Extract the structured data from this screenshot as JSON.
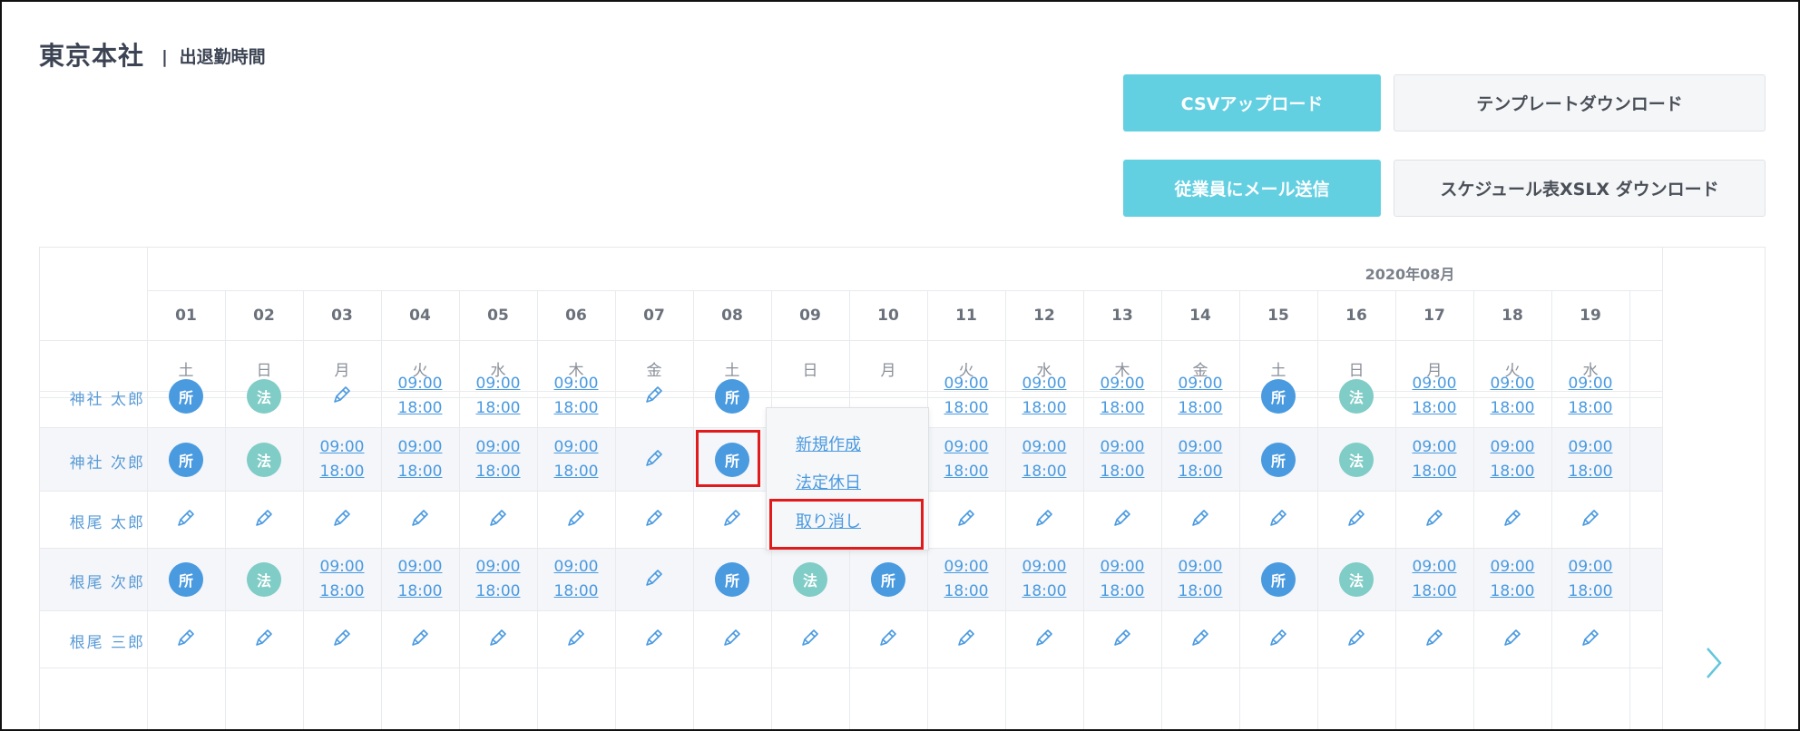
{
  "header": {
    "title": "東京本社",
    "subtitle_separator": "|",
    "subtitle": "出退勤時間"
  },
  "toolbar": {
    "csv_upload_label": "CSVアップロード",
    "template_download_label": "テンプレートダウンロード",
    "email_employees_label": "従業員にメール送信",
    "xlsx_download_label": "スケジュール表XSLX ダウンロード"
  },
  "colors": {
    "accent": "#63d0e2",
    "link": "#4a9ae0",
    "badge_sho": "#4a9ae0",
    "badge_ho": "#80ccc6",
    "highlight": "#e11b1b"
  },
  "schedule": {
    "month": "2020年08月",
    "days": [
      {
        "date": "01",
        "wd": "土"
      },
      {
        "date": "02",
        "wd": "日"
      },
      {
        "date": "03",
        "wd": "月"
      },
      {
        "date": "04",
        "wd": "火"
      },
      {
        "date": "05",
        "wd": "水"
      },
      {
        "date": "06",
        "wd": "木"
      },
      {
        "date": "07",
        "wd": "金"
      },
      {
        "date": "08",
        "wd": "土"
      },
      {
        "date": "09",
        "wd": "日"
      },
      {
        "date": "10",
        "wd": "月"
      },
      {
        "date": "11",
        "wd": "火"
      },
      {
        "date": "12",
        "wd": "水"
      },
      {
        "date": "13",
        "wd": "木"
      },
      {
        "date": "14",
        "wd": "金"
      },
      {
        "date": "15",
        "wd": "土"
      },
      {
        "date": "16",
        "wd": "日"
      },
      {
        "date": "17",
        "wd": "月"
      },
      {
        "date": "18",
        "wd": "火"
      },
      {
        "date": "19",
        "wd": "水"
      }
    ],
    "time": {
      "start": "09:00",
      "end": "18:00"
    },
    "badges": {
      "sho": "所",
      "ho": "法"
    },
    "cell_legend": {
      "S": "sho-badge",
      "H": "ho-badge",
      "T": "time-range",
      "P": "pencil-edit-icon"
    },
    "employees": [
      {
        "name": "神社 太郎",
        "cells": [
          "S",
          "H",
          "P",
          "T",
          "T",
          "T",
          "P",
          "S",
          "",
          "",
          "T",
          "T",
          "T",
          "T",
          "S",
          "H",
          "T",
          "T",
          "T"
        ]
      },
      {
        "name": "神社 次郎",
        "cells": [
          "S",
          "H",
          "T",
          "T",
          "T",
          "T",
          "P",
          "S",
          "",
          "",
          "T",
          "T",
          "T",
          "T",
          "S",
          "H",
          "T",
          "T",
          "T"
        ]
      },
      {
        "name": "根尾 太郎",
        "cells": [
          "P",
          "P",
          "P",
          "P",
          "P",
          "P",
          "P",
          "P",
          "P",
          "P",
          "P",
          "P",
          "P",
          "P",
          "P",
          "P",
          "P",
          "P",
          "P"
        ]
      },
      {
        "name": "根尾 次郎",
        "cells": [
          "S",
          "H",
          "T",
          "T",
          "T",
          "T",
          "P",
          "S",
          "H",
          "S",
          "T",
          "T",
          "T",
          "T",
          "S",
          "H",
          "T",
          "T",
          "T"
        ]
      },
      {
        "name": "根尾 三郎",
        "cells": [
          "P",
          "P",
          "P",
          "P",
          "P",
          "P",
          "P",
          "P",
          "P",
          "P",
          "P",
          "P",
          "P",
          "P",
          "P",
          "P",
          "P",
          "P",
          "P"
        ]
      }
    ]
  },
  "popup_menu": {
    "items": [
      "新規作成",
      "法定休日",
      "取り消し"
    ]
  }
}
